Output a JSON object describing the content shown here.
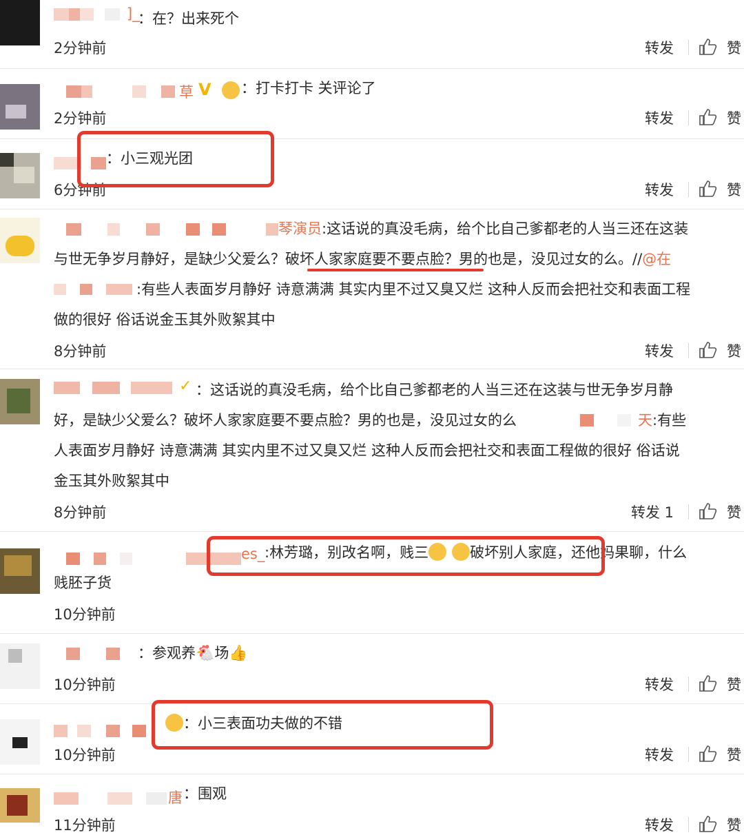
{
  "comments": [
    {
      "name_suffix": "]_",
      "text": "：在？出来死个",
      "time": "2分钟前",
      "forward": "转发",
      "like": "赞"
    },
    {
      "name_suffix": "草",
      "badge": "V",
      "text": "：打卡打卡  关评论了",
      "time": "2分钟前",
      "forward": "转发",
      "like": "赞"
    },
    {
      "text": "：小三观光团",
      "time": "6分钟前",
      "forward": "转发",
      "like": "赞"
    },
    {
      "name_suffix": "琴演员",
      "text_line1": ":这话说的真没毛病，给个比自己爹都老的人当三还在这装",
      "text_line2_a": "与世无争岁月静好，是缺少父爱么？",
      "text_line2_b": "破坏人家家庭要不要点脸",
      "text_line2_c": "？男的也是，没见过女的么。//",
      "mention": "@在",
      "text_line3": ":有些人表面岁月静好 诗意满满 其实内里不过又臭又烂 这种人反而会把社交和表面工程",
      "text_line4": "做的很好 俗话说金玉其外败絮其中",
      "time": "8分钟前",
      "forward": "转发",
      "like": "赞"
    },
    {
      "text_line1": "：这话说的真没毛病，给个比自己爹都老的人当三还在这装与世无争岁月静",
      "text_line2": "好，是缺少父爱么？破坏人家家庭要不要点脸？男的也是，没见过女的么",
      "mention": "天",
      "text_line2_end": ":有些",
      "text_line3": "人表面岁月静好 诗意满满 其实内里不过又臭又烂 这种人反而会把社交和表面工程做的很好 俗话说",
      "text_line4": "金玉其外败絮其中",
      "time": "8分钟前",
      "forward": "转发 1",
      "like": "赞"
    },
    {
      "name_suffix": "es_",
      "text_line1_a": ":林芳璐，别改名啊，贱三",
      "text_line1_b": "破坏别人家庭，",
      "text_line1_c": "还他妈果聊，什么",
      "text_line2": "贱胚子货",
      "time": "10分钟前"
    },
    {
      "text_a": "：参观养",
      "text_b": "场",
      "time": "10分钟前",
      "forward": "转发",
      "like": "赞"
    },
    {
      "text": "：小三表面功夫做的不错",
      "time": "10分钟前",
      "forward": "转发",
      "like": "赞"
    },
    {
      "name_suffix": "唐",
      "text": "：围观",
      "time": "11分钟前",
      "forward": "转发",
      "like": "赞"
    }
  ],
  "colors": {
    "accent_orange": "#eb7350",
    "highlight_red": "#e23b2e",
    "verify_gold": "#f4b400"
  }
}
